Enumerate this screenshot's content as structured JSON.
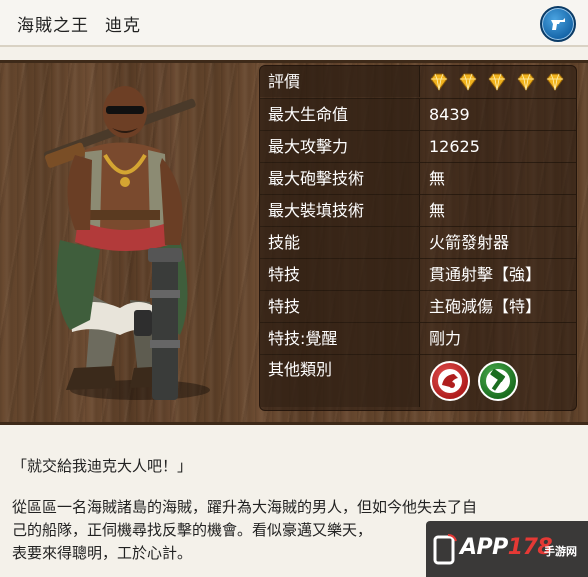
{
  "header": {
    "title_main": "海賊之王",
    "title_name": "迪克",
    "weapon_icon": "revolver-icon",
    "accent": "#1d6fb5"
  },
  "stats": {
    "rows": [
      {
        "label": "評價",
        "value": ""
      },
      {
        "label": "最大生命值",
        "value": "8439"
      },
      {
        "label": "最大攻擊力",
        "value": "12625"
      },
      {
        "label": "最大砲擊技術",
        "value": "無"
      },
      {
        "label": "最大裝填技術",
        "value": "無"
      },
      {
        "label": "技能",
        "value": "火箭發射器"
      },
      {
        "label": "特技",
        "value": "貫通射擊【強】"
      },
      {
        "label": "特技",
        "value": "主砲減傷【特】"
      },
      {
        "label": "特技:覺醒",
        "value": "剛力"
      },
      {
        "label": "其他類別",
        "value": ""
      }
    ],
    "rating_gems": 5,
    "rating_icon": "gold-diamond-icon",
    "categories": [
      {
        "icon": "cannon-shield-icon",
        "color": "#c62828"
      },
      {
        "icon": "hammer-icon",
        "color": "#2e7d32"
      }
    ]
  },
  "text": {
    "quote": "「就交給我迪克大人吧！」",
    "description_lines": [
      "從區區一名海賊諸島的海賊，躍升為大海賊的男人，但如今他失去了自",
      "己的船隊，正伺機尋找反擊的機會。看似豪邁又樂天，",
      "表要來得聰明，工於心計。"
    ]
  },
  "watermark": {
    "text_a": "APP",
    "text_b": "178",
    "text_sub": "手游网"
  }
}
